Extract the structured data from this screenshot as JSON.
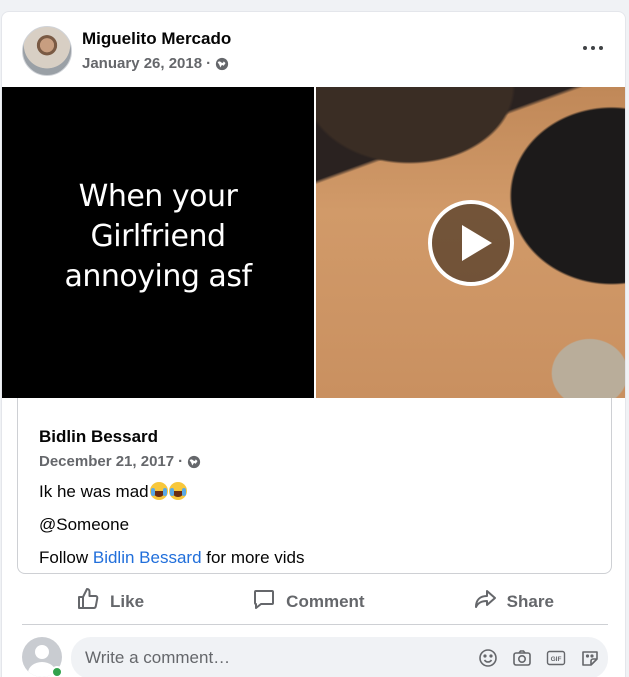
{
  "post": {
    "author": "Miguelito Mercado",
    "date": "January 26, 2018",
    "separator": "·",
    "privacy_icon": "globe-icon",
    "more_icon": "more-options-icon"
  },
  "media": {
    "left_caption": "When your Girlfriend annoying asf",
    "play_icon": "play-icon"
  },
  "shared_post": {
    "author": "Bidlin Bessard",
    "date": "December 21, 2017",
    "separator": "·",
    "line1_text": "Ik he was mad",
    "line1_emoji": "face-with-tears-of-joy-emoji",
    "line2_text": "@Someone",
    "line3_prefix": "Follow ",
    "line3_link": "Bidlin Bessard",
    "line3_suffix": " for more vids"
  },
  "actions": {
    "like": "Like",
    "comment": "Comment",
    "share": "Share"
  },
  "composer": {
    "placeholder": "Write a comment…",
    "icons": [
      "emoji-icon",
      "camera-icon",
      "gif-icon",
      "sticker-icon"
    ]
  },
  "colors": {
    "link": "#216fdb",
    "meta_text": "#65676b",
    "online": "#31a24c",
    "input_bg": "#f0f2f5"
  }
}
